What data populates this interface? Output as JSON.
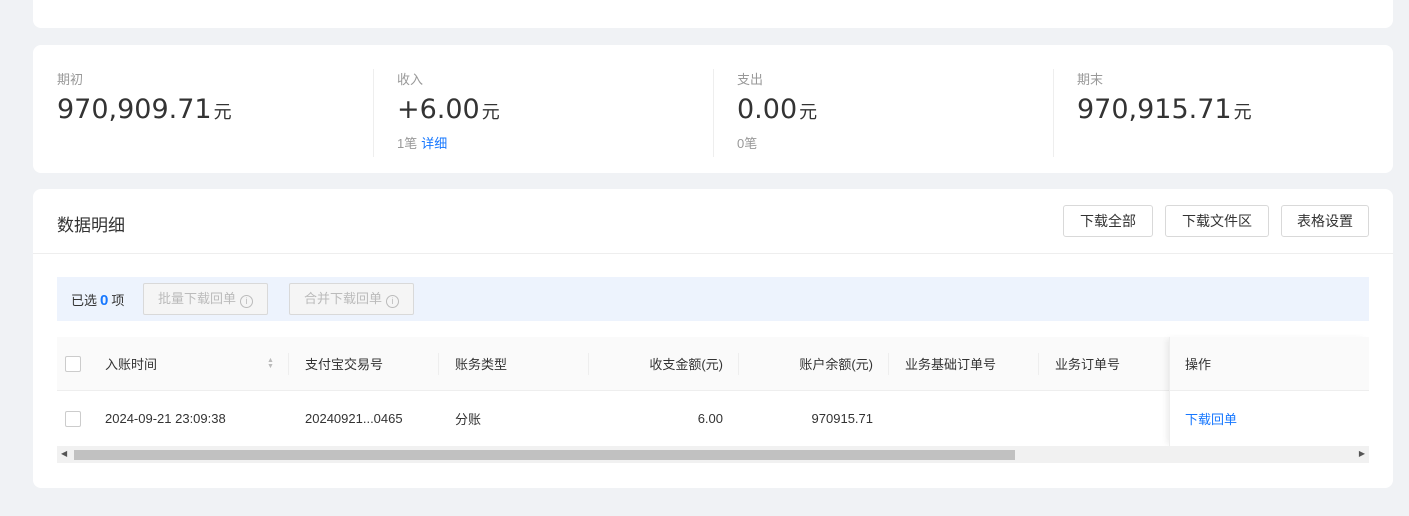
{
  "top": {
    "cut_text": ""
  },
  "stats": [
    {
      "label": "期初",
      "value": "970,909.71",
      "unit": "元",
      "sub_count": "",
      "sub_link": ""
    },
    {
      "label": "收入",
      "value": "+6.00",
      "unit": "元",
      "sub_count": "1笔",
      "sub_link": "详细"
    },
    {
      "label": "支出",
      "value": "0.00",
      "unit": "元",
      "sub_count": "0笔",
      "sub_link": ""
    },
    {
      "label": "期末",
      "value": "970,915.71",
      "unit": "元",
      "sub_count": "",
      "sub_link": ""
    }
  ],
  "detail": {
    "title": "数据明细",
    "buttons": {
      "download_all": "下载全部",
      "download_area": "下载文件区",
      "table_settings": "表格设置"
    },
    "selection": {
      "prefix": "已选",
      "count": "0",
      "suffix": "项",
      "batch_download": "批量下载回单",
      "merge_download": "合并下载回单"
    },
    "columns": {
      "time": "入账时间",
      "trade_no": "支付宝交易号",
      "type": "账务类型",
      "amount": "收支金额(元)",
      "balance": "账户余额(元)",
      "base_order": "业务基础订单号",
      "order": "业务订单号",
      "action": "操作"
    },
    "rows": [
      {
        "time": "2024-09-21 23:09:38",
        "trade_no": "20240921...0465",
        "type": "分账",
        "amount": "6.00",
        "balance": "970915.71",
        "base_order": "",
        "order": "",
        "action": "下载回单"
      }
    ]
  }
}
